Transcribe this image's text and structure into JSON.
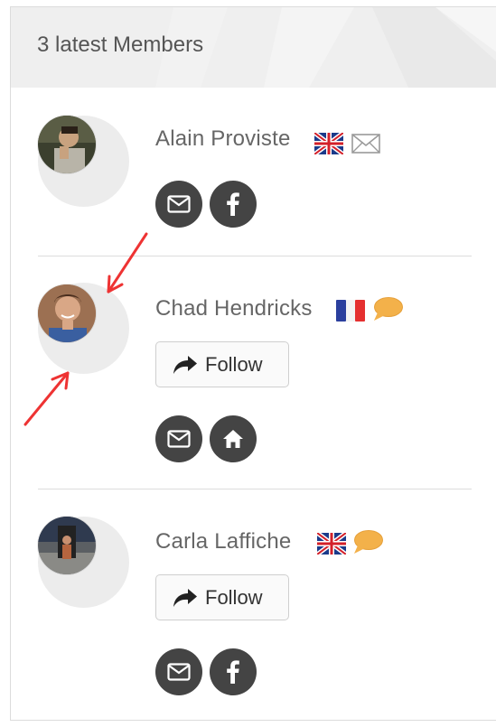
{
  "widget": {
    "title": "3 latest Members"
  },
  "members": [
    {
      "name": "Alain Proviste",
      "flag": "uk-flag",
      "status_icon": "envelope-outline-icon",
      "show_follow": false,
      "actions": [
        "envelope-icon",
        "facebook-icon"
      ]
    },
    {
      "name": "Chad Hendricks",
      "flag": "france-flag",
      "status_icon": "speech-bubble-icon",
      "show_follow": true,
      "follow_label": "Follow",
      "actions": [
        "envelope-icon",
        "home-icon"
      ]
    },
    {
      "name": "Carla Laffiche",
      "flag": "uk-flag",
      "status_icon": "speech-bubble-icon",
      "show_follow": true,
      "follow_label": "Follow",
      "actions": [
        "envelope-icon",
        "facebook-icon"
      ]
    }
  ],
  "colors": {
    "header_bg": "#efefef",
    "button_dark": "#444444",
    "annotation_arrow": "#ee3333",
    "chat_bubble": "#f3b14a"
  }
}
